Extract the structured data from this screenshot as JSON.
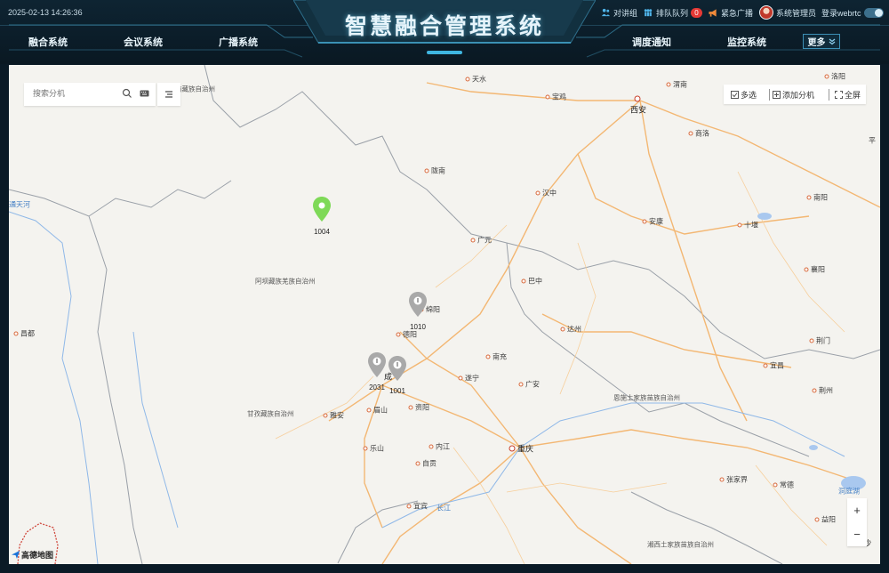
{
  "header": {
    "datetime": "2025-02-13 14:26:36",
    "title": "智慧融合管理系统",
    "tools": {
      "intercom": "对讲组",
      "queue": "排队队列",
      "queue_count": "0",
      "broadcast": "紧急广播",
      "admin": "系统管理员",
      "webrtc": "登录webrtc"
    },
    "nav_left": [
      "融合系统",
      "会议系统",
      "广播系统"
    ],
    "nav_right": [
      "调度通知",
      "监控系统"
    ],
    "more": "更多"
  },
  "map": {
    "search_placeholder": "搜索分机",
    "tools": {
      "multi_select": "多选",
      "add_extension": "添加分机",
      "fullscreen": "全屏"
    },
    "zoom_in": "+",
    "zoom_out": "−",
    "logo": "高德地图",
    "places": {
      "tianshui": "天水",
      "baoji": "宝鸡",
      "weinan": "渭南",
      "xian": "西安",
      "shangluo": "商洛",
      "longnan": "陇南",
      "hanzhong": "汉中",
      "ankang": "安康",
      "shiyan": "十堰",
      "nanyang": "南阳",
      "guangyuan": "广元",
      "bazhong": "巴中",
      "dazhou": "达州",
      "xiangyang": "襄阳",
      "jingmen": "荆门",
      "yichang": "宜昌",
      "jingzhou": "荆州",
      "mianyang": "绵阳",
      "deyang": "德阳",
      "nanchong": "南充",
      "suining": "遂宁",
      "guangan": "广安",
      "chengdu": "成",
      "ziyang": "资阳",
      "meishan": "眉山",
      "yaan": "雅安",
      "leshan": "乐山",
      "neijiang": "内江",
      "zigong": "自贡",
      "yibin": "宜宾",
      "chongqing": "重庆",
      "zhangjiajie": "张家界",
      "changde": "常德",
      "yiyang": "益阳",
      "luoyang": "洛阳",
      "changjiang": "长江",
      "dongtinghu": "洞庭湖",
      "tongtianhe": "通天河",
      "sha": "沙",
      "ping": "平",
      "changdu": "昌都",
      "gannan": "南藏族自治州",
      "aba": "阿坝藏族羌族自治州",
      "ganzi": "甘孜藏族自治州",
      "enshi": "恩施土家族苗族自治州",
      "xiangxi": "湘西土家族苗族自治州"
    },
    "markers": [
      {
        "id": "1004",
        "color": "#7ed957"
      },
      {
        "id": "1010",
        "color": "#a9a9a9"
      },
      {
        "id": "2031",
        "color": "#a9a9a9"
      },
      {
        "id": "1001",
        "color": "#a9a9a9"
      }
    ]
  }
}
